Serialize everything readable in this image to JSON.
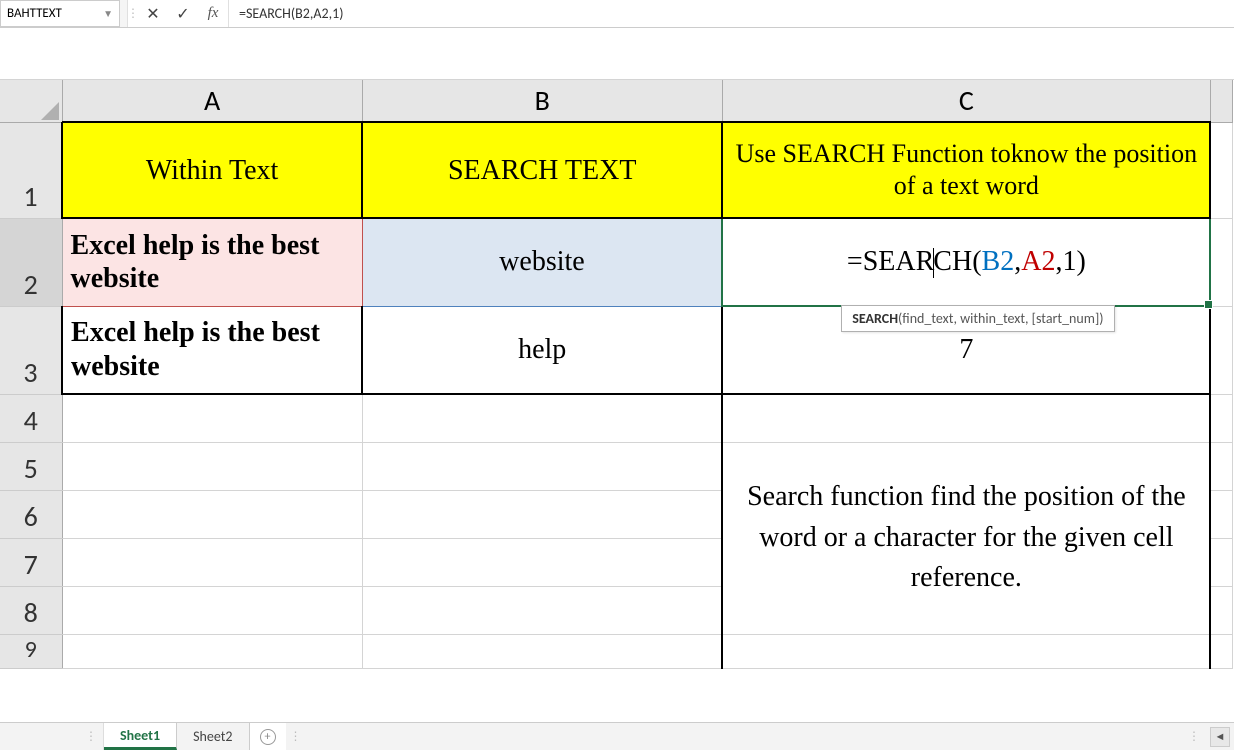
{
  "nameBox": "BAHTTEXT",
  "formulaBar": "=SEARCH(B2,A2,1)",
  "columns": [
    "A",
    "B",
    "C"
  ],
  "rows": [
    "1",
    "2",
    "3",
    "4",
    "5",
    "6",
    "7",
    "8",
    "9"
  ],
  "headers": {
    "A": "Within Text",
    "B": "SEARCH TEXT",
    "C": "Use SEARCH Function toknow the position of a text word"
  },
  "row2": {
    "A": "Excel help is the best website",
    "B": "website",
    "C_prefix": "=SEAR",
    "C_mid": "CH(",
    "C_b2": "B2",
    "C_comma1": ",",
    "C_a2": "A2",
    "C_suffix": ",1)"
  },
  "row3": {
    "A": "Excel help is the best website",
    "B": "help",
    "C": "7"
  },
  "tooltip": {
    "fn": "SEARCH",
    "args": "(find_text, within_text, [start_num])"
  },
  "note": "Search function find the position of the word or a character for the given cell reference.",
  "tabs": {
    "sheet1": "Sheet1",
    "sheet2": "Sheet2"
  },
  "fx_label": "fx"
}
